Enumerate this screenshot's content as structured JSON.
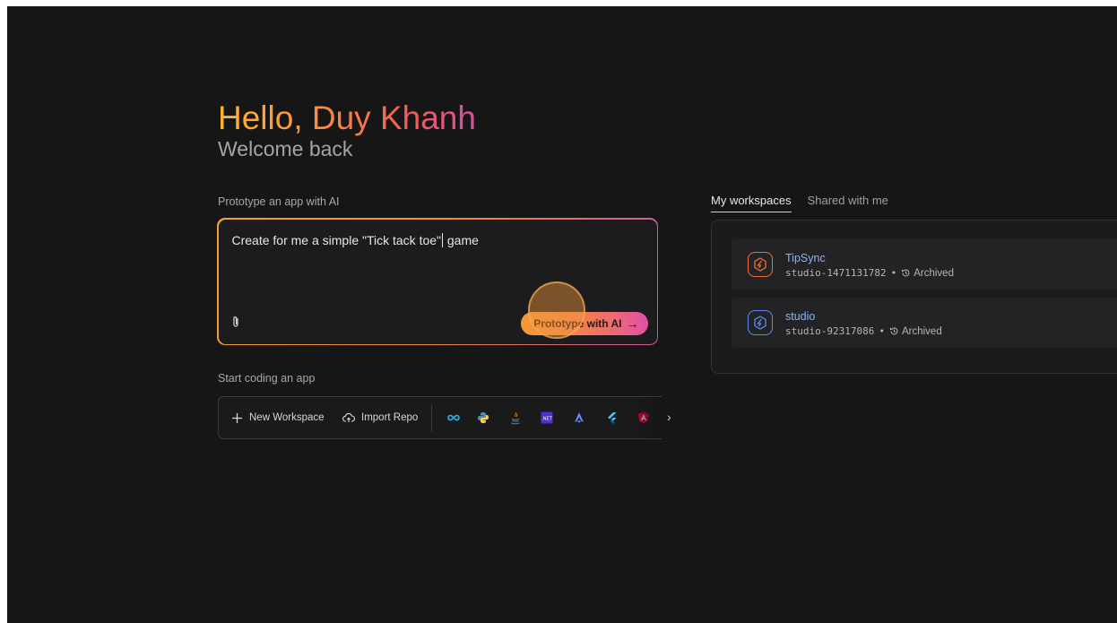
{
  "greeting": {
    "title": "Hello, Duy Khanh",
    "subtitle": "Welcome back"
  },
  "prototype": {
    "label": "Prototype an app with AI",
    "input_value_before_caret": "Create for me a simple \"Tick tack toe\"",
    "input_value_after_caret": " game",
    "button_label": "Prototype with AI",
    "button_arrow": "→",
    "attach_icon": "paperclip-icon"
  },
  "start_coding": {
    "label": "Start coding an app",
    "new_workspace": "New Workspace",
    "import_repo": "Import Repo",
    "templates": [
      "flutter-dart-icon",
      "python-icon",
      "java-icon",
      "dotnet-icon",
      "astro-icon",
      "flutter-icon",
      "angular-icon"
    ],
    "next_icon": "›"
  },
  "workspaces": {
    "tabs": [
      {
        "label": "My workspaces",
        "active": true
      },
      {
        "label": "Shared with me",
        "active": false
      }
    ],
    "items": [
      {
        "name": "TipSync",
        "id": "studio-1471131782",
        "separator": "•",
        "status": "Archived",
        "icon_color": "#f26b3a"
      },
      {
        "name": "studio",
        "id": "studio-92317086",
        "separator": "•",
        "status": "Archived",
        "icon_color": "#5b8def"
      }
    ]
  },
  "colors": {
    "background": "#161617",
    "accent_orange": "#f79a36",
    "accent_pink": "#e150a6",
    "link_blue": "#8ab4f8"
  }
}
